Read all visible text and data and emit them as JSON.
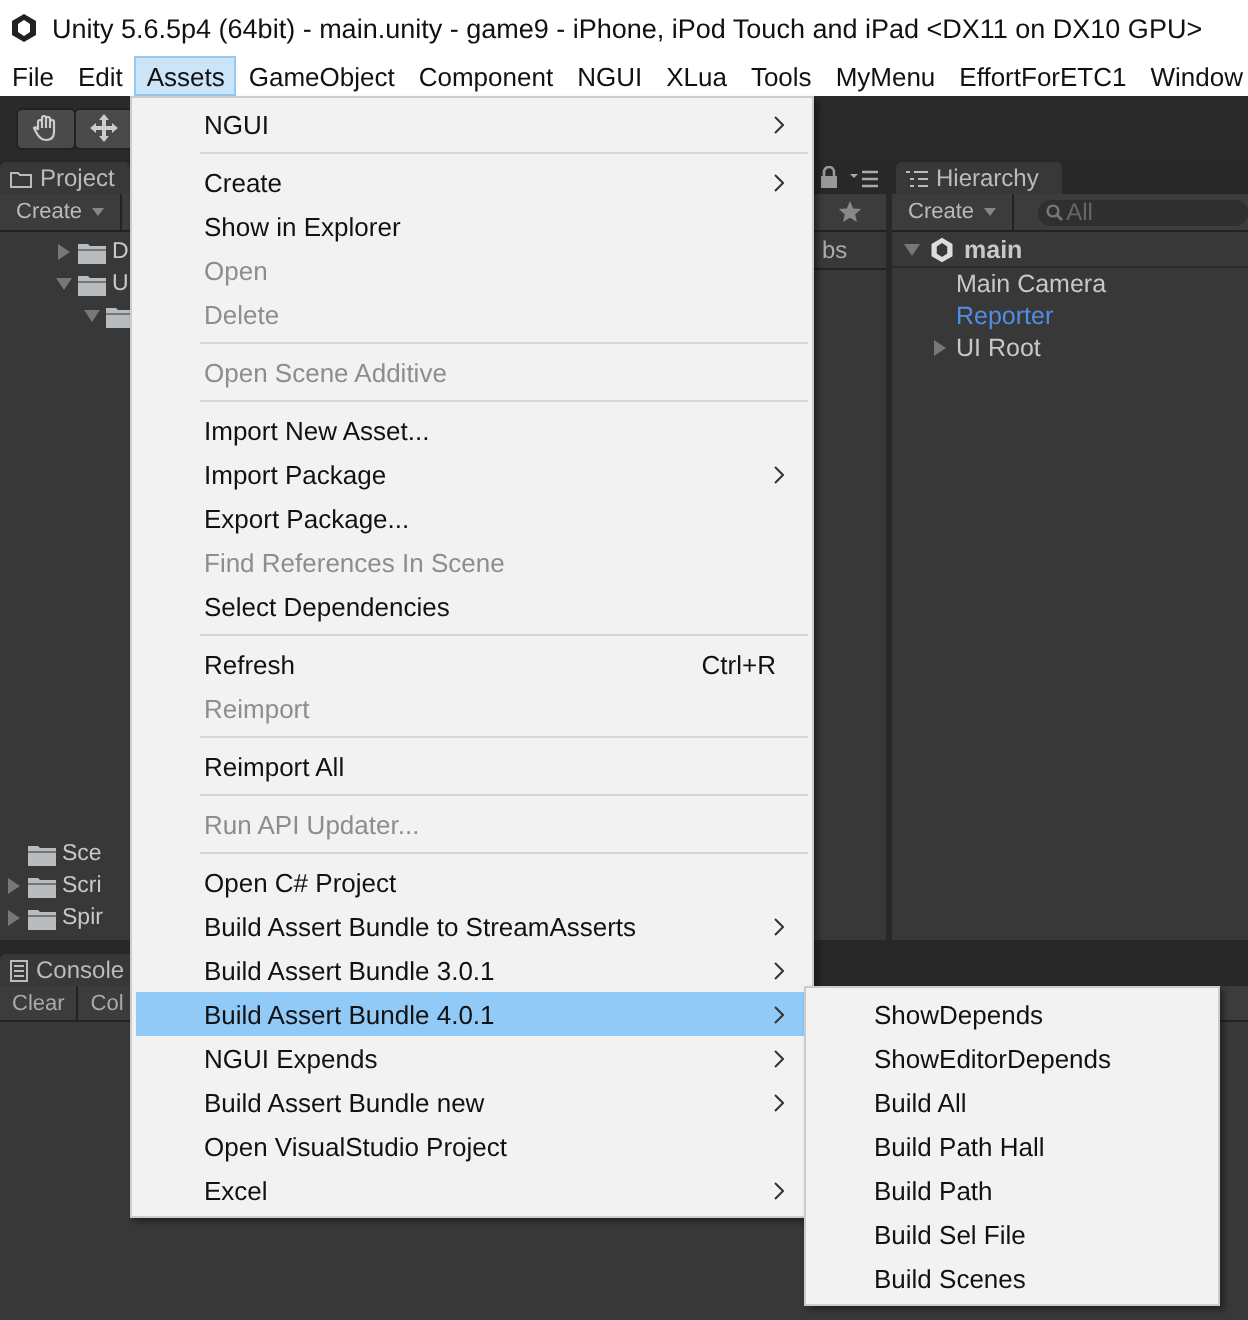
{
  "window": {
    "title": "Unity 5.6.5p4 (64bit) - main.unity - game9 - iPhone, iPod Touch and iPad <DX11 on DX10 GPU>"
  },
  "menubar": [
    {
      "label": "File",
      "selected": false
    },
    {
      "label": "Edit",
      "selected": false
    },
    {
      "label": "Assets",
      "selected": true
    },
    {
      "label": "GameObject",
      "selected": false
    },
    {
      "label": "Component",
      "selected": false
    },
    {
      "label": "NGUI",
      "selected": false
    },
    {
      "label": "XLua",
      "selected": false
    },
    {
      "label": "Tools",
      "selected": false
    },
    {
      "label": "MyMenu",
      "selected": false
    },
    {
      "label": "EffortForETC1",
      "selected": false
    },
    {
      "label": "Window",
      "selected": false
    }
  ],
  "project": {
    "tab": "Project",
    "create": "Create",
    "breadcrumb": "bs",
    "tree_top": [
      {
        "label": "D",
        "expanded": false
      },
      {
        "label": "U",
        "expanded": true
      }
    ],
    "tree_bottom": [
      {
        "label": "Sce",
        "has_children": false
      },
      {
        "label": "Scri",
        "has_children": true
      },
      {
        "label": "Spir",
        "has_children": true
      }
    ]
  },
  "hierarchy": {
    "tab": "Hierarchy",
    "create": "Create",
    "search": {
      "placeholder": "All"
    },
    "scene": {
      "label": "main",
      "expanded": true,
      "children": [
        {
          "label": "Main Camera",
          "prefab": false,
          "has_children": false
        },
        {
          "label": "Reporter",
          "prefab": true,
          "has_children": false
        },
        {
          "label": "UI Root",
          "prefab": false,
          "has_children": true
        }
      ]
    }
  },
  "console": {
    "tab": "Console",
    "buttons": [
      "Clear",
      "Col"
    ]
  },
  "menu": [
    {
      "kind": "item",
      "label": "NGUI",
      "submenu": true,
      "disabled": false,
      "selected": false
    },
    {
      "kind": "separator"
    },
    {
      "kind": "item",
      "label": "Create",
      "submenu": true,
      "disabled": false,
      "selected": false
    },
    {
      "kind": "item",
      "label": "Show in Explorer",
      "submenu": false,
      "disabled": false,
      "selected": false
    },
    {
      "kind": "item",
      "label": "Open",
      "submenu": false,
      "disabled": true,
      "selected": false
    },
    {
      "kind": "item",
      "label": "Delete",
      "submenu": false,
      "disabled": true,
      "selected": false
    },
    {
      "kind": "separator"
    },
    {
      "kind": "item",
      "label": "Open Scene Additive",
      "submenu": false,
      "disabled": true,
      "selected": false
    },
    {
      "kind": "separator"
    },
    {
      "kind": "item",
      "label": "Import New Asset...",
      "submenu": false,
      "disabled": false,
      "selected": false
    },
    {
      "kind": "item",
      "label": "Import Package",
      "submenu": true,
      "disabled": false,
      "selected": false
    },
    {
      "kind": "item",
      "label": "Export Package...",
      "submenu": false,
      "disabled": false,
      "selected": false
    },
    {
      "kind": "item",
      "label": "Find References In Scene",
      "submenu": false,
      "disabled": true,
      "selected": false
    },
    {
      "kind": "item",
      "label": "Select Dependencies",
      "submenu": false,
      "disabled": false,
      "selected": false
    },
    {
      "kind": "separator"
    },
    {
      "kind": "item",
      "label": "Refresh",
      "shortcut": "Ctrl+R",
      "submenu": false,
      "disabled": false,
      "selected": false
    },
    {
      "kind": "item",
      "label": "Reimport",
      "submenu": false,
      "disabled": true,
      "selected": false
    },
    {
      "kind": "separator"
    },
    {
      "kind": "item",
      "label": "Reimport All",
      "submenu": false,
      "disabled": false,
      "selected": false
    },
    {
      "kind": "separator"
    },
    {
      "kind": "item",
      "label": "Run API Updater...",
      "submenu": false,
      "disabled": true,
      "selected": false
    },
    {
      "kind": "separator"
    },
    {
      "kind": "item",
      "label": "Open C# Project",
      "submenu": false,
      "disabled": false,
      "selected": false
    },
    {
      "kind": "item",
      "label": "Build Assert Bundle to StreamAsserts",
      "submenu": true,
      "disabled": false,
      "selected": false
    },
    {
      "kind": "item",
      "label": "Build Assert Bundle 3.0.1",
      "submenu": true,
      "disabled": false,
      "selected": false
    },
    {
      "kind": "item",
      "label": "Build Assert Bundle 4.0.1",
      "submenu": true,
      "disabled": false,
      "selected": true
    },
    {
      "kind": "item",
      "label": "NGUI Expends",
      "submenu": true,
      "disabled": false,
      "selected": false
    },
    {
      "kind": "item",
      "label": "Build Assert Bundle new",
      "submenu": true,
      "disabled": false,
      "selected": false
    },
    {
      "kind": "item",
      "label": "Open VisualStudio Project",
      "submenu": false,
      "disabled": false,
      "selected": false
    },
    {
      "kind": "item",
      "label": "Excel",
      "submenu": true,
      "disabled": false,
      "selected": false
    }
  ],
  "submenu": [
    {
      "label": "ShowDepends"
    },
    {
      "label": "ShowEditorDepends"
    },
    {
      "label": "Build All"
    },
    {
      "label": "Build Path Hall"
    },
    {
      "label": "Build Path"
    },
    {
      "label": "Build Sel File"
    },
    {
      "label": "Build Scenes"
    }
  ]
}
